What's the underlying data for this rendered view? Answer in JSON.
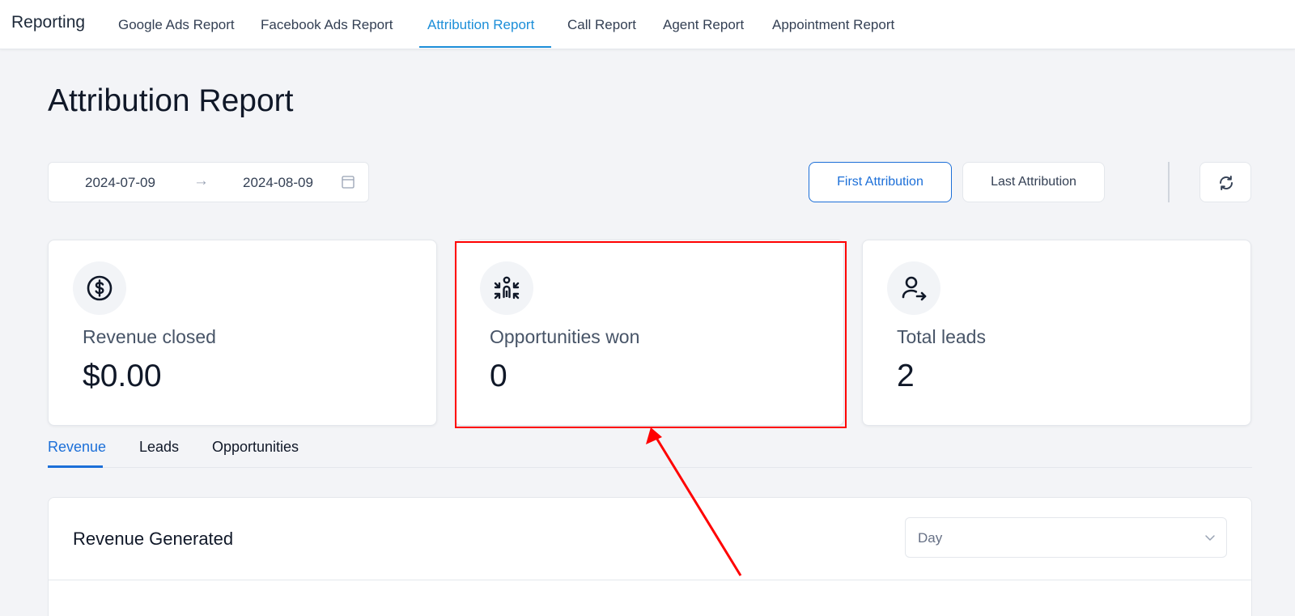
{
  "nav": {
    "brand": "Reporting",
    "tabs": [
      {
        "label": "Google Ads Report"
      },
      {
        "label": "Facebook Ads Report"
      },
      {
        "label": "Attribution Report"
      },
      {
        "label": "Call Report"
      },
      {
        "label": "Agent Report"
      },
      {
        "label": "Appointment Report"
      }
    ],
    "active_tab": "Attribution Report"
  },
  "page": {
    "title": "Attribution Report"
  },
  "date_range": {
    "start": "2024-07-09",
    "arrow": "→",
    "end": "2024-08-09"
  },
  "attribution": {
    "first_label": "First Attribution",
    "last_label": "Last Attribution",
    "selected": "First Attribution"
  },
  "cards": [
    {
      "icon": "dollar-circle-icon",
      "label": "Revenue closed",
      "value": "$0.00"
    },
    {
      "icon": "opportunities-icon",
      "label": "Opportunities won",
      "value": "0"
    },
    {
      "icon": "user-arrow-icon",
      "label": "Total leads",
      "value": "2"
    }
  ],
  "subtabs": [
    {
      "label": "Revenue"
    },
    {
      "label": "Leads"
    },
    {
      "label": "Opportunities"
    }
  ],
  "active_subtab": "Revenue",
  "panel": {
    "title": "Revenue Generated",
    "granularity": "Day"
  },
  "colors": {
    "accent": "#1c8ed8",
    "primary": "#1c6fd8",
    "highlight": "#ff0000",
    "background": "#f3f4f7"
  }
}
